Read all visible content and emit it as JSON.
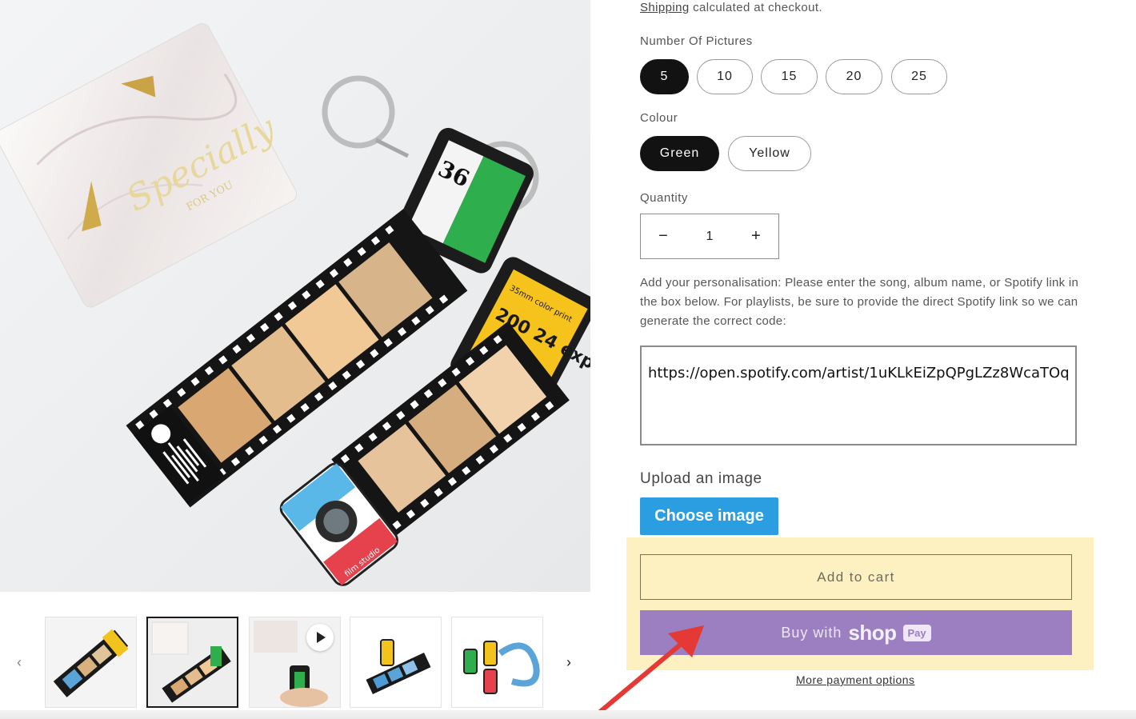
{
  "shipping": {
    "link": "Shipping",
    "text": " calculated at checkout."
  },
  "pictures": {
    "label": "Number Of Pictures",
    "options": [
      "5",
      "10",
      "15",
      "20",
      "25"
    ],
    "selected": "5"
  },
  "colour": {
    "label": "Colour",
    "options": [
      "Green",
      "Yellow"
    ],
    "selected": "Green"
  },
  "quantity": {
    "label": "Quantity",
    "value": "1",
    "minus": "−",
    "plus": "+"
  },
  "personalisation": {
    "instructions": "Add your personalisation: Please enter the song, album name, or Spotify link in the box below. For playlists, be sure to provide the direct Spotify link so we can generate the correct code:",
    "value": "https://open.spotify.com/artist/1uKLkEiZpQPgLZz8WcaTOq"
  },
  "upload": {
    "label": "Upload an image",
    "button": "Choose image"
  },
  "cart": {
    "add_to_cart": "Add to cart"
  },
  "shop_pay": {
    "buy_with": "Buy with",
    "shop": "shop",
    "pay": "Pay"
  },
  "more_payment": "More payment options",
  "gallery": {
    "prev": "‹",
    "next": "›"
  },
  "product_image": {
    "box_text": "Specially",
    "box_subtext": "FOR YOU",
    "canister_number": "36",
    "canister2_text": "200 24 exp.",
    "canister2_sub": "35mm color print",
    "camera_text": "film studio"
  },
  "colors": {
    "accent_black": "#121212",
    "choose_button": "#2a9ee0",
    "shop_pay": "#9b7fc1",
    "highlight": "#fdf1c2",
    "arrow": "#e53935"
  }
}
